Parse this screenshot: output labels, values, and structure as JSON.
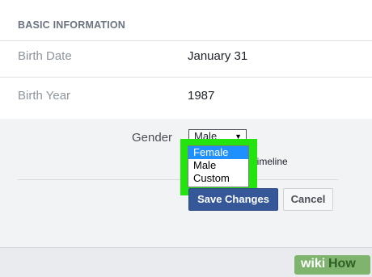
{
  "section": {
    "heading": "BASIC INFORMATION"
  },
  "rows": [
    {
      "label": "Birth Date",
      "value": "January 31"
    },
    {
      "label": "Birth Year",
      "value": "1987"
    }
  ],
  "gender": {
    "label": "Gender",
    "selected_value": "Male",
    "options": [
      "Female",
      "Male",
      "Custom"
    ],
    "highlighted_option": "Female"
  },
  "timeline_text": "y timeline",
  "buttons": {
    "save": "Save Changes",
    "cancel": "Cancel"
  },
  "watermark": {
    "wiki": "wiki",
    "how": "How"
  },
  "colors": {
    "save_button": "#365899",
    "highlight_outline": "#23e40f",
    "selected_option": "#1e90ff",
    "watermark_bg": "#7fb46f"
  }
}
